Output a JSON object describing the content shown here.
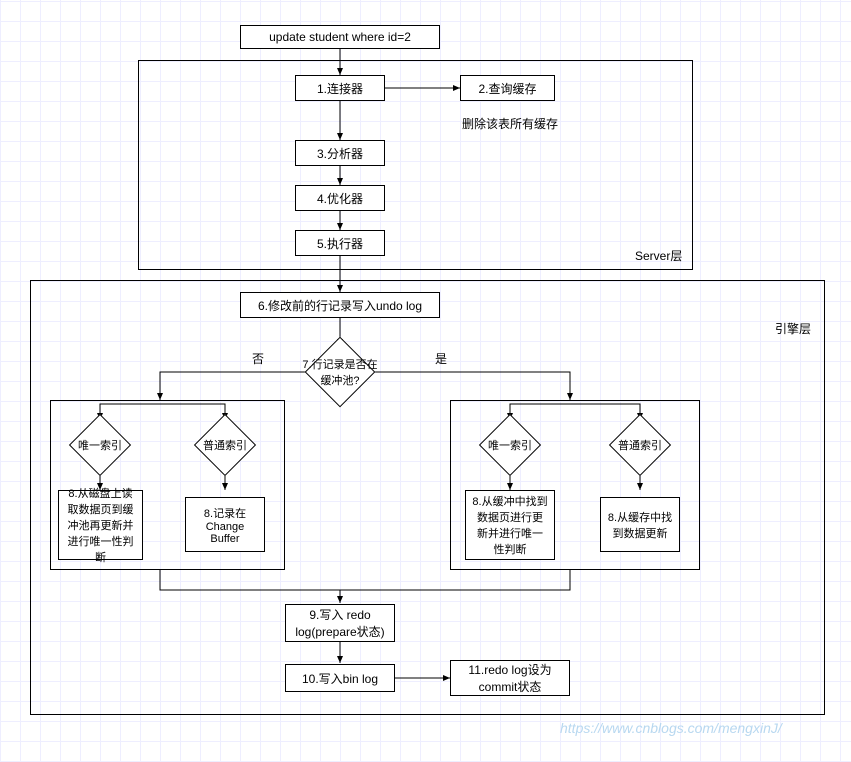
{
  "nodes": {
    "start": "update student where id=2",
    "n1": "1.连接器",
    "n2": "2.查询缓存",
    "cache_note": "删除该表所有缓存",
    "n3": "3.分析器",
    "n4": "4.优化器",
    "n5": "5.执行器",
    "server_label": "Server层",
    "n6": "6.修改前的行记录写入undo log",
    "engine_label": "引擎层",
    "d7": "7.行记录是否在缓冲池?",
    "no": "否",
    "yes": "是",
    "d_left_unique": "唯一索引",
    "d_left_normal": "普通索引",
    "d_right_unique": "唯一索引",
    "d_right_normal": "普通索引",
    "n8_lu": "8.从磁盘上读取数据页到缓冲池再更新并进行唯一性判断",
    "n8_ln": "8.记录在Change Buffer",
    "n8_ru": "8.从缓冲中找到数据页进行更新并进行唯一性判断",
    "n8_rn": "8.从缓存中找到数据更新",
    "n9": "9.写入 redo log(prepare状态)",
    "n10": "10.写入bin log",
    "n11": "11.redo log设为commit状态"
  },
  "watermark": "https://www.cnblogs.com/mengxinJ/"
}
